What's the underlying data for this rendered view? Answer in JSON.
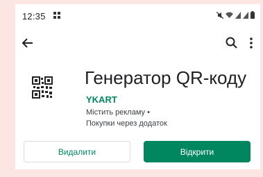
{
  "status_bar": {
    "time": "12:35",
    "icons": [
      "notification-icon",
      "mute-icon",
      "wifi-icon",
      "signal-icon",
      "signal-icon",
      "battery-icon"
    ]
  },
  "app_bar": {
    "icons": [
      "back-arrow-icon",
      "search-icon",
      "more-vert-icon"
    ]
  },
  "app": {
    "title": "Генератор QR-коду",
    "developer": "YKART",
    "contains_ads": "Містить рекламу",
    "separator": "•",
    "in_app_purchases": "Покупки через додаток",
    "icon": "qr-code-icon"
  },
  "actions": {
    "uninstall_label": "Видалити",
    "open_label": "Відкрити"
  },
  "colors": {
    "accent": "#01875f",
    "background": "#fbe6e3"
  }
}
